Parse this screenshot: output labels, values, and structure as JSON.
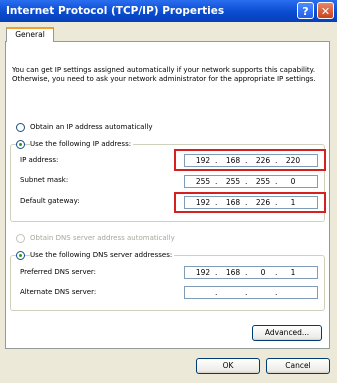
{
  "window": {
    "title": "Internet Protocol (TCP/IP) Properties",
    "help_symbol": "?",
    "close_symbol": "✕"
  },
  "tabs": [
    {
      "label": "General"
    }
  ],
  "description": "You can get IP settings assigned automatically if your network supports this capability. Otherwise, you need to ask your network administrator for the appropriate IP settings.",
  "ip_section": {
    "auto_label": "Obtain an IP address automatically",
    "manual_label": "Use the following IP address:",
    "selected": "manual",
    "fields": [
      {
        "label": "IP address:",
        "octets": [
          "192",
          "168",
          "226",
          "220"
        ],
        "highlighted": true
      },
      {
        "label": "Subnet mask:",
        "octets": [
          "255",
          "255",
          "255",
          "0"
        ],
        "highlighted": false
      },
      {
        "label": "Default gateway:",
        "octets": [
          "192",
          "168",
          "226",
          "1"
        ],
        "highlighted": true
      }
    ]
  },
  "dns_section": {
    "auto_label": "Obtain DNS server address automatically",
    "auto_disabled": true,
    "manual_label": "Use the following DNS server addresses:",
    "selected": "manual",
    "fields": [
      {
        "label": "Preferred DNS server:",
        "octets": [
          "192",
          "168",
          "0",
          "1"
        ]
      },
      {
        "label": "Alternate DNS server:",
        "octets": [
          "",
          "",
          "",
          ""
        ]
      }
    ]
  },
  "buttons": {
    "advanced": "Advanced...",
    "ok": "OK",
    "cancel": "Cancel"
  },
  "colors": {
    "highlight": "#d42020",
    "title_bar": "#0a4bd0",
    "radio_dot": "#21A121"
  }
}
